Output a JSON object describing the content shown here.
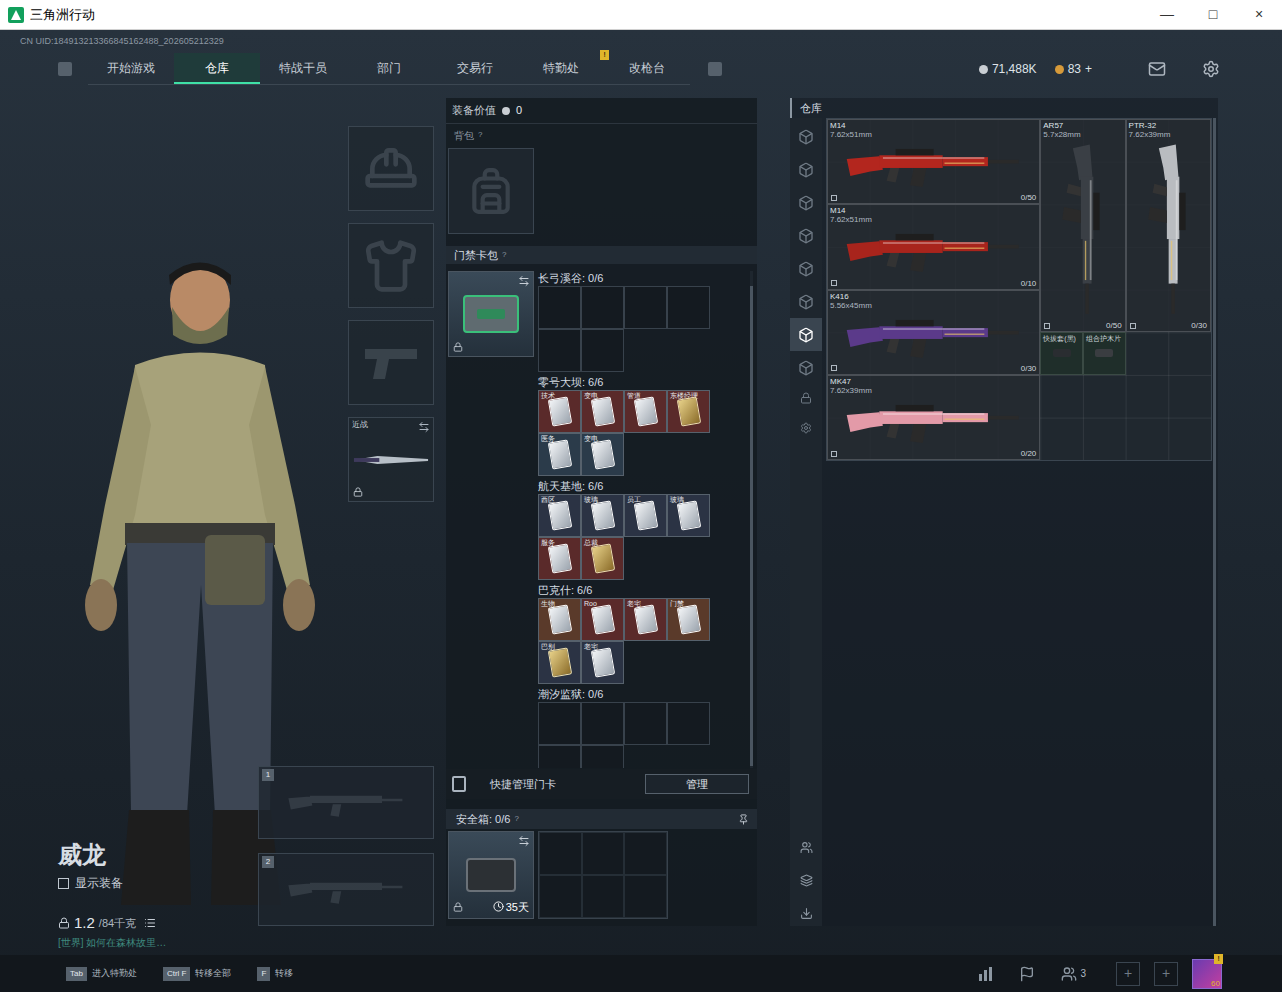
{
  "window": {
    "title": "三角洲行动",
    "controls": [
      "—",
      "□",
      "×"
    ]
  },
  "uid": "CN UID:184913213366845162488_202605212329",
  "nav": {
    "tabs": [
      {
        "label": "开始游戏",
        "selected": false
      },
      {
        "label": "仓库",
        "selected": true
      },
      {
        "label": "特战干员",
        "selected": false
      },
      {
        "label": "部门",
        "selected": false
      },
      {
        "label": "交易行",
        "selected": false
      },
      {
        "label": "特勤处",
        "selected": false,
        "badge": "!"
      },
      {
        "label": "改枪台",
        "selected": false
      }
    ],
    "currency": "71,488K",
    "tokens": "83",
    "add": "+"
  },
  "operator": {
    "name": "威龙",
    "show_equipment": {
      "label": "显示装备",
      "checked": false
    },
    "weight": "1.2",
    "capacity": "/84千克",
    "chat": "[世界] 如何在森林故里…"
  },
  "gear_slots": [
    {
      "kind": "helmet",
      "locked": false
    },
    {
      "kind": "armor",
      "locked": false
    },
    {
      "kind": "pistol",
      "locked": false
    },
    {
      "kind": "melee",
      "label": "近战",
      "locked": true
    }
  ],
  "weapon_slots": [
    "1",
    "2"
  ],
  "loadout": {
    "value_label": "装备价值",
    "value": "0",
    "backpack": {
      "label": "背包",
      "help": "?"
    },
    "keycard_case": {
      "label": "门禁卡包",
      "help": "?",
      "locked": true
    },
    "keycard_lists": [
      {
        "title": "长弓溪谷: 0/6",
        "cards": []
      },
      {
        "title": "零号大坝: 6/6",
        "cards": [
          {
            "label": "技术",
            "kind": "silver",
            "color": "#5a2a2a"
          },
          {
            "label": "变电",
            "kind": "silver",
            "color": "#5a2a2a"
          },
          {
            "label": "管道",
            "kind": "silver",
            "color": "#5a2a2a"
          },
          {
            "label": "东楼经理",
            "kind": "gold",
            "color": "#5a2a2a"
          },
          {
            "label": "医务",
            "kind": "silver",
            "color": "#2b3b4a"
          },
          {
            "label": "变电",
            "kind": "silver",
            "color": "#2b3b4a"
          }
        ]
      },
      {
        "title": "航天基地: 6/6",
        "cards": [
          {
            "label": "西区",
            "kind": "silver",
            "color": "#2b3344"
          },
          {
            "label": "玻璃",
            "kind": "silver",
            "color": "#2b3344"
          },
          {
            "label": "员工",
            "kind": "silver",
            "color": "#2b3344"
          },
          {
            "label": "玻璃",
            "kind": "silver",
            "color": "#2b3344"
          },
          {
            "label": "服务",
            "kind": "silver",
            "color": "#5a2a2a"
          },
          {
            "label": "总裁",
            "kind": "gold",
            "color": "#5a2a2a"
          }
        ]
      },
      {
        "title": "巴克什: 6/6",
        "cards": [
          {
            "label": "生物",
            "kind": "silver",
            "color": "#5a3a2a"
          },
          {
            "label": "Roo",
            "kind": "silver",
            "color": "#5a2a2a"
          },
          {
            "label": "老宅",
            "kind": "silver",
            "color": "#5a2a2a"
          },
          {
            "label": "门禁",
            "kind": "silver",
            "color": "#5a3a2a"
          },
          {
            "label": "巴别",
            "kind": "gold",
            "color": "#2b3344"
          },
          {
            "label": "老宅",
            "kind": "silver",
            "color": "#2b3344"
          }
        ]
      },
      {
        "title": "潮汐监狱: 0/6",
        "cards": []
      }
    ],
    "quick_manage": {
      "label": "快捷管理门卡",
      "button": "管理"
    },
    "safe_box": {
      "title": "安全箱: 0/6",
      "help": "?",
      "days": "35天",
      "locked": true
    }
  },
  "warehouse": {
    "title": "仓库",
    "tabs": [
      {
        "selected": false
      },
      {
        "selected": false
      },
      {
        "selected": false
      },
      {
        "selected": false
      },
      {
        "selected": false
      },
      {
        "selected": false
      },
      {
        "selected": true
      },
      {
        "selected": false
      }
    ],
    "items": [
      {
        "kind": "rifle",
        "name": "M14",
        "caliber": "7.62x51mm",
        "ammo": "0/50",
        "color": "#b3261e"
      },
      {
        "kind": "rifle",
        "name": "M14",
        "caliber": "7.62x51mm",
        "ammo": "0/10",
        "color": "#a8241c"
      },
      {
        "kind": "rifle",
        "name": "K416",
        "caliber": "5.56x45mm",
        "ammo": "0/30",
        "color": "#5b3a8a"
      },
      {
        "kind": "rifle",
        "name": "MK47",
        "caliber": "7.62x39mm",
        "ammo": "0/20",
        "color": "#e39aa8"
      },
      {
        "kind": "rifle-tall",
        "name": "AR57",
        "caliber": "5.7x28mm",
        "ammo": "0/50",
        "color": "#3a3f45"
      },
      {
        "kind": "rifle-tall",
        "name": "PTR-32",
        "caliber": "7.62x39mm",
        "ammo": "0/30",
        "color": "#b9bcc0"
      },
      {
        "kind": "part",
        "name": "快拔套(黑)",
        "color": "#2a2d31"
      },
      {
        "kind": "part",
        "name": "组合护木片",
        "color": "#3a3d41"
      }
    ]
  },
  "bottom": {
    "hints": [
      {
        "key": "Tab",
        "label": "进入特勤处"
      },
      {
        "key": "Ctrl F",
        "label": "转移全部"
      },
      {
        "key": "F",
        "label": "转移"
      }
    ],
    "friends": "3",
    "plus_slots": [
      "+",
      "+"
    ],
    "avatar_badge": "!",
    "level": "60"
  }
}
